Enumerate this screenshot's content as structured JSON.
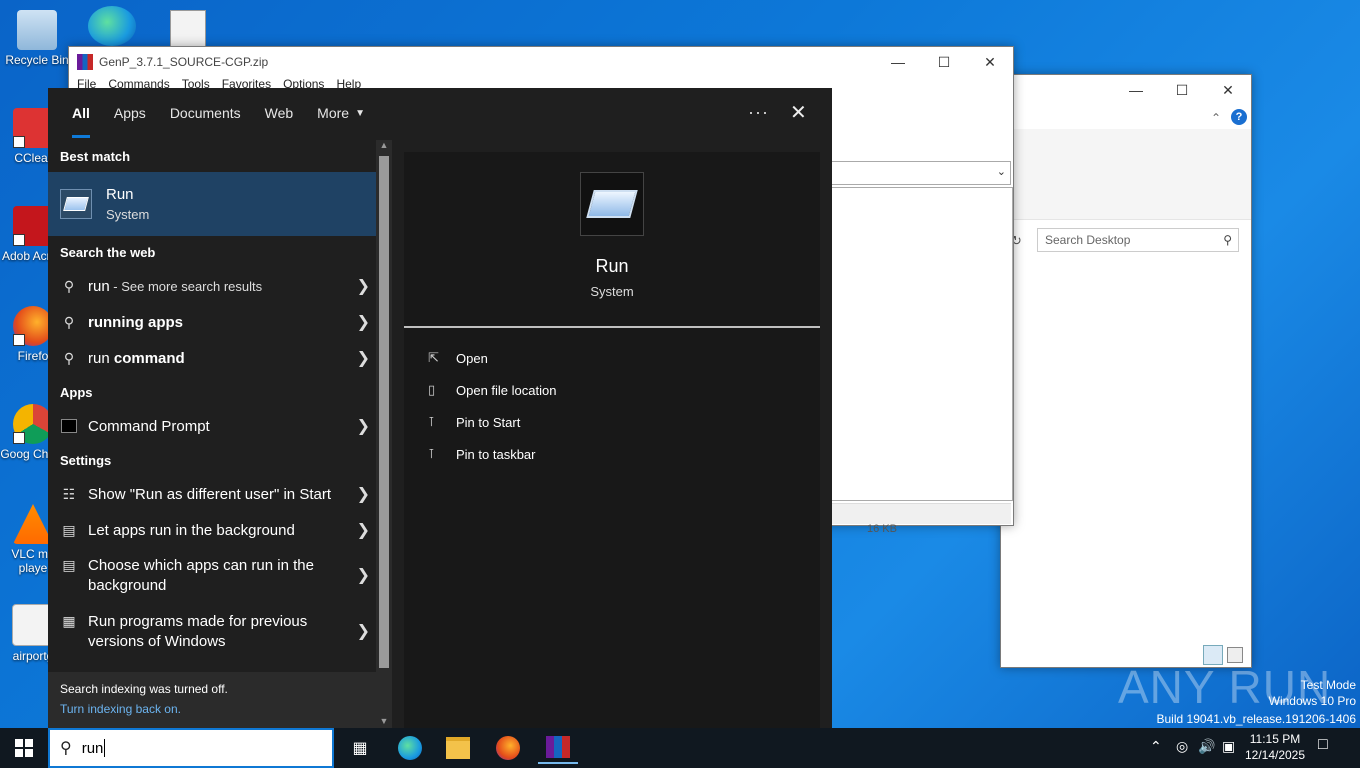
{
  "desktop": {
    "icons": [
      {
        "label": "Recycle Bin"
      },
      {
        "label": "CClear"
      },
      {
        "label": "Adob Acrob"
      },
      {
        "label": "Firefo"
      },
      {
        "label": "Goog Chron"
      },
      {
        "label": "VLC me playe"
      },
      {
        "label": "airportg"
      }
    ]
  },
  "winrar_window": {
    "title": "GenP_3.7.1_SOURCE-CGP.zip",
    "menu": [
      "File",
      "Commands",
      "Tools",
      "Favorites",
      "Options",
      "Help"
    ],
    "file_size": "16 KB"
  },
  "explorer_window": {
    "search_placeholder": "Search Desktop"
  },
  "search_panel": {
    "tabs": [
      "All",
      "Apps",
      "Documents",
      "Web",
      "More"
    ],
    "more_icon": "ellipsis-icon",
    "close_icon": "close-icon",
    "best_match_header": "Best match",
    "best_match": {
      "title": "Run",
      "subtitle": "System"
    },
    "web_header": "Search the web",
    "web_results": [
      {
        "prefix": "run",
        "suffix": " - See more search results"
      },
      {
        "prefix": "running apps",
        "suffix": ""
      },
      {
        "prefix": "run ",
        "suffix": "command"
      }
    ],
    "apps_header": "Apps",
    "apps": [
      {
        "label": "Command Prompt"
      }
    ],
    "settings_header": "Settings",
    "settings": [
      {
        "label": "Show \"Run as different user\" in Start"
      },
      {
        "label": "Let apps run in the background"
      },
      {
        "label": "Choose which apps can run in the background"
      },
      {
        "label": "Run programs made for previous versions of Windows"
      }
    ],
    "indexing_notice": "Search indexing was turned off.",
    "indexing_link": "Turn indexing back on.",
    "preview": {
      "title": "Run",
      "subtitle": "System",
      "actions": [
        "Open",
        "Open file location",
        "Pin to Start",
        "Pin to taskbar"
      ]
    }
  },
  "taskbar": {
    "search_value": "run",
    "time": "11:15 PM",
    "date": "12/14/2025"
  },
  "watermark": {
    "line1": "Test Mode",
    "line2": "Windows 10 Pro",
    "line3": "Build 19041.vb_release.191206-1406",
    "brand": "ANY RUN"
  }
}
